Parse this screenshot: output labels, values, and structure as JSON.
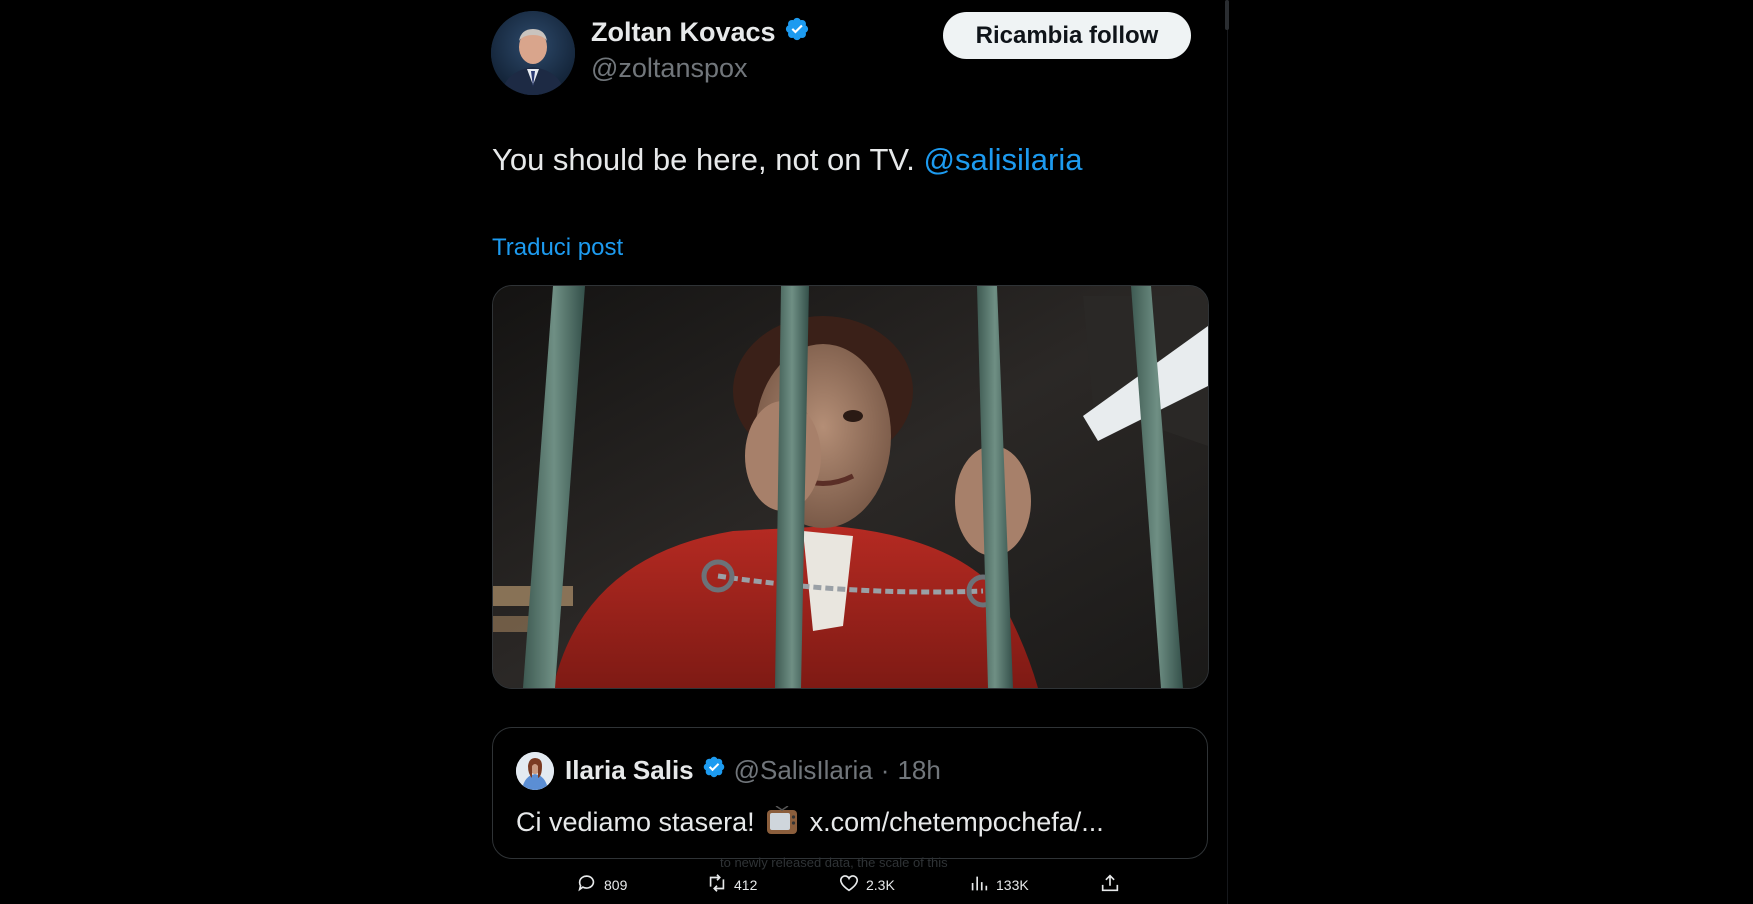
{
  "author": {
    "name": "Zoltan Kovacs",
    "handle": "@zoltanspox",
    "avatar_icon": "avatar-photo-man-in-suit",
    "verified_icon": "verified-badge-icon"
  },
  "follow_button": {
    "label": "Ricambia follow"
  },
  "post": {
    "text": "You should be here, not on TV.",
    "mention": "@salisilaria",
    "translate_label": "Traduci post",
    "media_icon": "image-woman-behind-bars"
  },
  "quoted_post": {
    "name": "Ilaria Salis",
    "handle": "@SalisIlaria",
    "separator": "·",
    "time": "18h",
    "text_before": "Ci vediamo stasera!",
    "emoji_icon": "television-emoji-icon",
    "text_after": "x.com/chetempochefa/..."
  },
  "ghost": {
    "line1": "to newly released data, the scale of this",
    "line2": "...."
  },
  "actions": {
    "replies": "809",
    "reposts": "412",
    "likes": "2.3K",
    "views": "133K",
    "reply_icon": "reply-icon",
    "repost_icon": "repost-icon",
    "like_icon": "heart-icon",
    "views_icon": "views-icon",
    "share_icon": "share-icon"
  },
  "colors": {
    "background": "#000000",
    "text": "#e7e9ea",
    "muted": "#71767b",
    "accent": "#1d9bf0",
    "border": "#2f3336"
  }
}
